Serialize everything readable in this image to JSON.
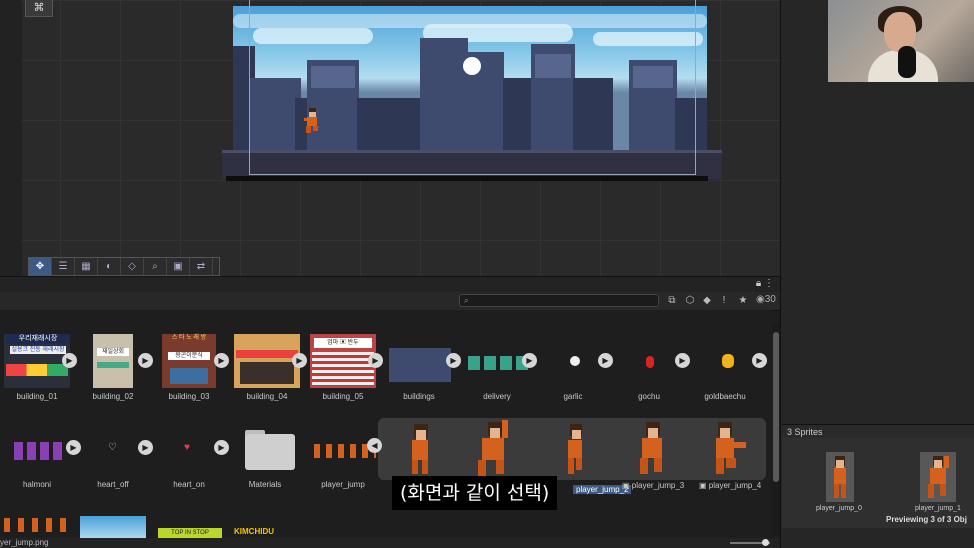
{
  "scene": {
    "tools": [
      "✥",
      "☰",
      "▦",
      "◐",
      "◇",
      "⌕",
      "▣",
      "⇄"
    ]
  },
  "project": {
    "search_placeholder": "",
    "item_count": "30",
    "assets_row1": [
      {
        "label": "building_01"
      },
      {
        "label": "building_02"
      },
      {
        "label": "building_03"
      },
      {
        "label": "building_04"
      },
      {
        "label": "building_05"
      },
      {
        "label": "buildings"
      },
      {
        "label": "delivery"
      },
      {
        "label": "garlic"
      },
      {
        "label": "gochu"
      },
      {
        "label": "goldbaechu"
      }
    ],
    "assets_row2": [
      {
        "label": "halmoni"
      },
      {
        "label": "heart_off"
      },
      {
        "label": "heart_on"
      },
      {
        "label": "Materials"
      },
      {
        "label": "player_jump"
      }
    ],
    "sub_assets": [
      {
        "label": "player_jump_2"
      },
      {
        "label": "player_jump_3"
      },
      {
        "label": "player_jump_4"
      }
    ],
    "status_file": "yer_jump.png"
  },
  "signs": {
    "b1_top": "우리재래시장",
    "b1_mid": "실용크 전통 재래시장",
    "b2_sign": "재일상회",
    "b3_top": "스 타 노 래 방",
    "b3_mid": "왕곤이분식",
    "b5_sign": "엄마 ▣ 반두",
    "row3_sign1": "TOP IN STOP",
    "row3_sign2": "KIMCHIDU"
  },
  "subtitle": "(화면과 같이 선택)",
  "preview": {
    "header": "3 Sprites",
    "thumb_labels": [
      "player_jump_0",
      "player_jump_1"
    ],
    "status": "Previewing 3 of 3 Obj"
  },
  "colors": {
    "accent": "#3d5a85",
    "panel_bg": "#1e1e1e",
    "sky_top": "#4aa0d8",
    "building": "#3e4b6e",
    "player_orange": "#d4621e"
  }
}
